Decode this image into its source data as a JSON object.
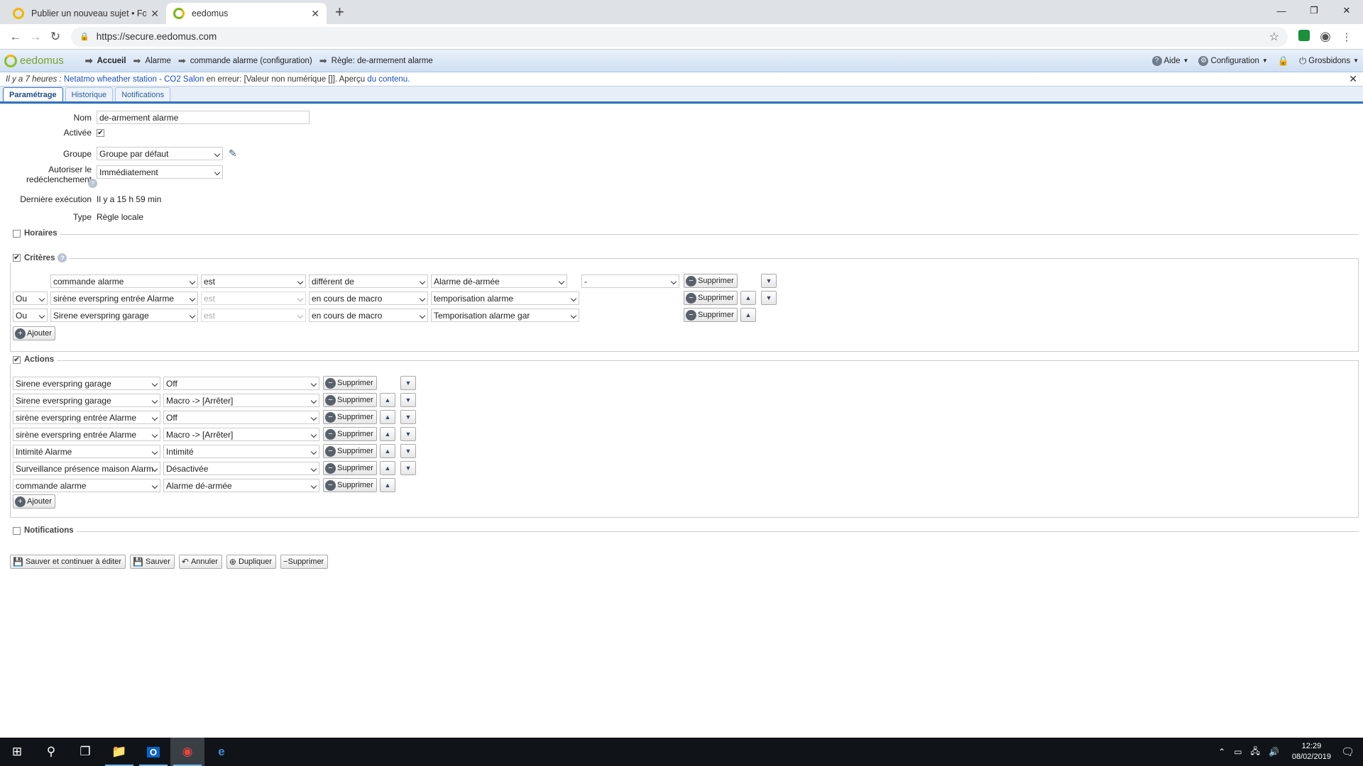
{
  "browser": {
    "tabs": [
      {
        "title": "Publier un nouveau sujet • Forum",
        "active": false
      },
      {
        "title": "eedomus",
        "active": true
      }
    ],
    "url": "https://secure.eedomus.com"
  },
  "header": {
    "logo": "eedomus",
    "breadcrumbs": [
      "Accueil",
      "Alarme",
      "commande alarme (configuration)",
      "Règle: de-armement alarme"
    ],
    "right": {
      "help": "Aide",
      "config": "Configuration",
      "user": "Grosbidons"
    }
  },
  "banner": {
    "time": "Il y a 7 heures :",
    "device": "Netatmo wheather station - CO2 Salon",
    "message": "en erreur: [Valeur non numérique []]. Aperçu",
    "link": "du contenu."
  },
  "tabs": [
    "Paramétrage",
    "Historique",
    "Notifications"
  ],
  "form": {
    "nom_label": "Nom",
    "nom_value": "de-armement alarme",
    "activee_label": "Activée",
    "groupe_label": "Groupe",
    "groupe_value": "Groupe par défaut",
    "autoriser_label1": "Autoriser le",
    "autoriser_label2": "redéclenchement",
    "autoriser_value": "Immédiatement",
    "derniere_label": "Dernière exécution",
    "derniere_value": "Il y a 15 h 59 min",
    "type_label": "Type",
    "type_value": "Règle locale"
  },
  "sections": {
    "horaires": "Horaires",
    "criteres": "Critères",
    "actions": "Actions",
    "notifications": "Notifications"
  },
  "criteria": [
    {
      "op": "",
      "device": "commande alarme",
      "cmp": "est",
      "cond": "différent de",
      "value": "Alarme dé-armée",
      "extra": "-"
    },
    {
      "op": "Ou",
      "device": "sirène everspring entrée Alarme",
      "cmp": "est",
      "cond": "en cours de macro",
      "value": "temporisation alarme",
      "extra": ""
    },
    {
      "op": "Ou",
      "device": "Sirene everspring garage",
      "cmp": "est",
      "cond": "en cours de macro",
      "value": "Temporisation alarme gar",
      "extra": ""
    }
  ],
  "actions": [
    {
      "device": "Sirene everspring garage",
      "value": "Off"
    },
    {
      "device": "Sirene everspring garage",
      "value": "Macro -> [Arrêter]"
    },
    {
      "device": "sirène everspring entrée Alarme",
      "value": "Off"
    },
    {
      "device": "sirène everspring entrée Alarme",
      "value": "Macro -> [Arrêter]"
    },
    {
      "device": "Intimité Alarme",
      "value": "Intimité"
    },
    {
      "device": "Surveillance présence maison Alarm",
      "value": "Désactivée"
    },
    {
      "device": "commande alarme",
      "value": "Alarme dé-armée"
    }
  ],
  "labels": {
    "supprimer": "Supprimer",
    "ajouter": "Ajouter"
  },
  "footer": {
    "save_continue": "Sauver et continuer à éditer",
    "save": "Sauver",
    "cancel": "Annuler",
    "duplicate": "Dupliquer",
    "delete": "Supprimer"
  },
  "taskbar": {
    "time": "12:29",
    "date": "08/02/2019"
  }
}
